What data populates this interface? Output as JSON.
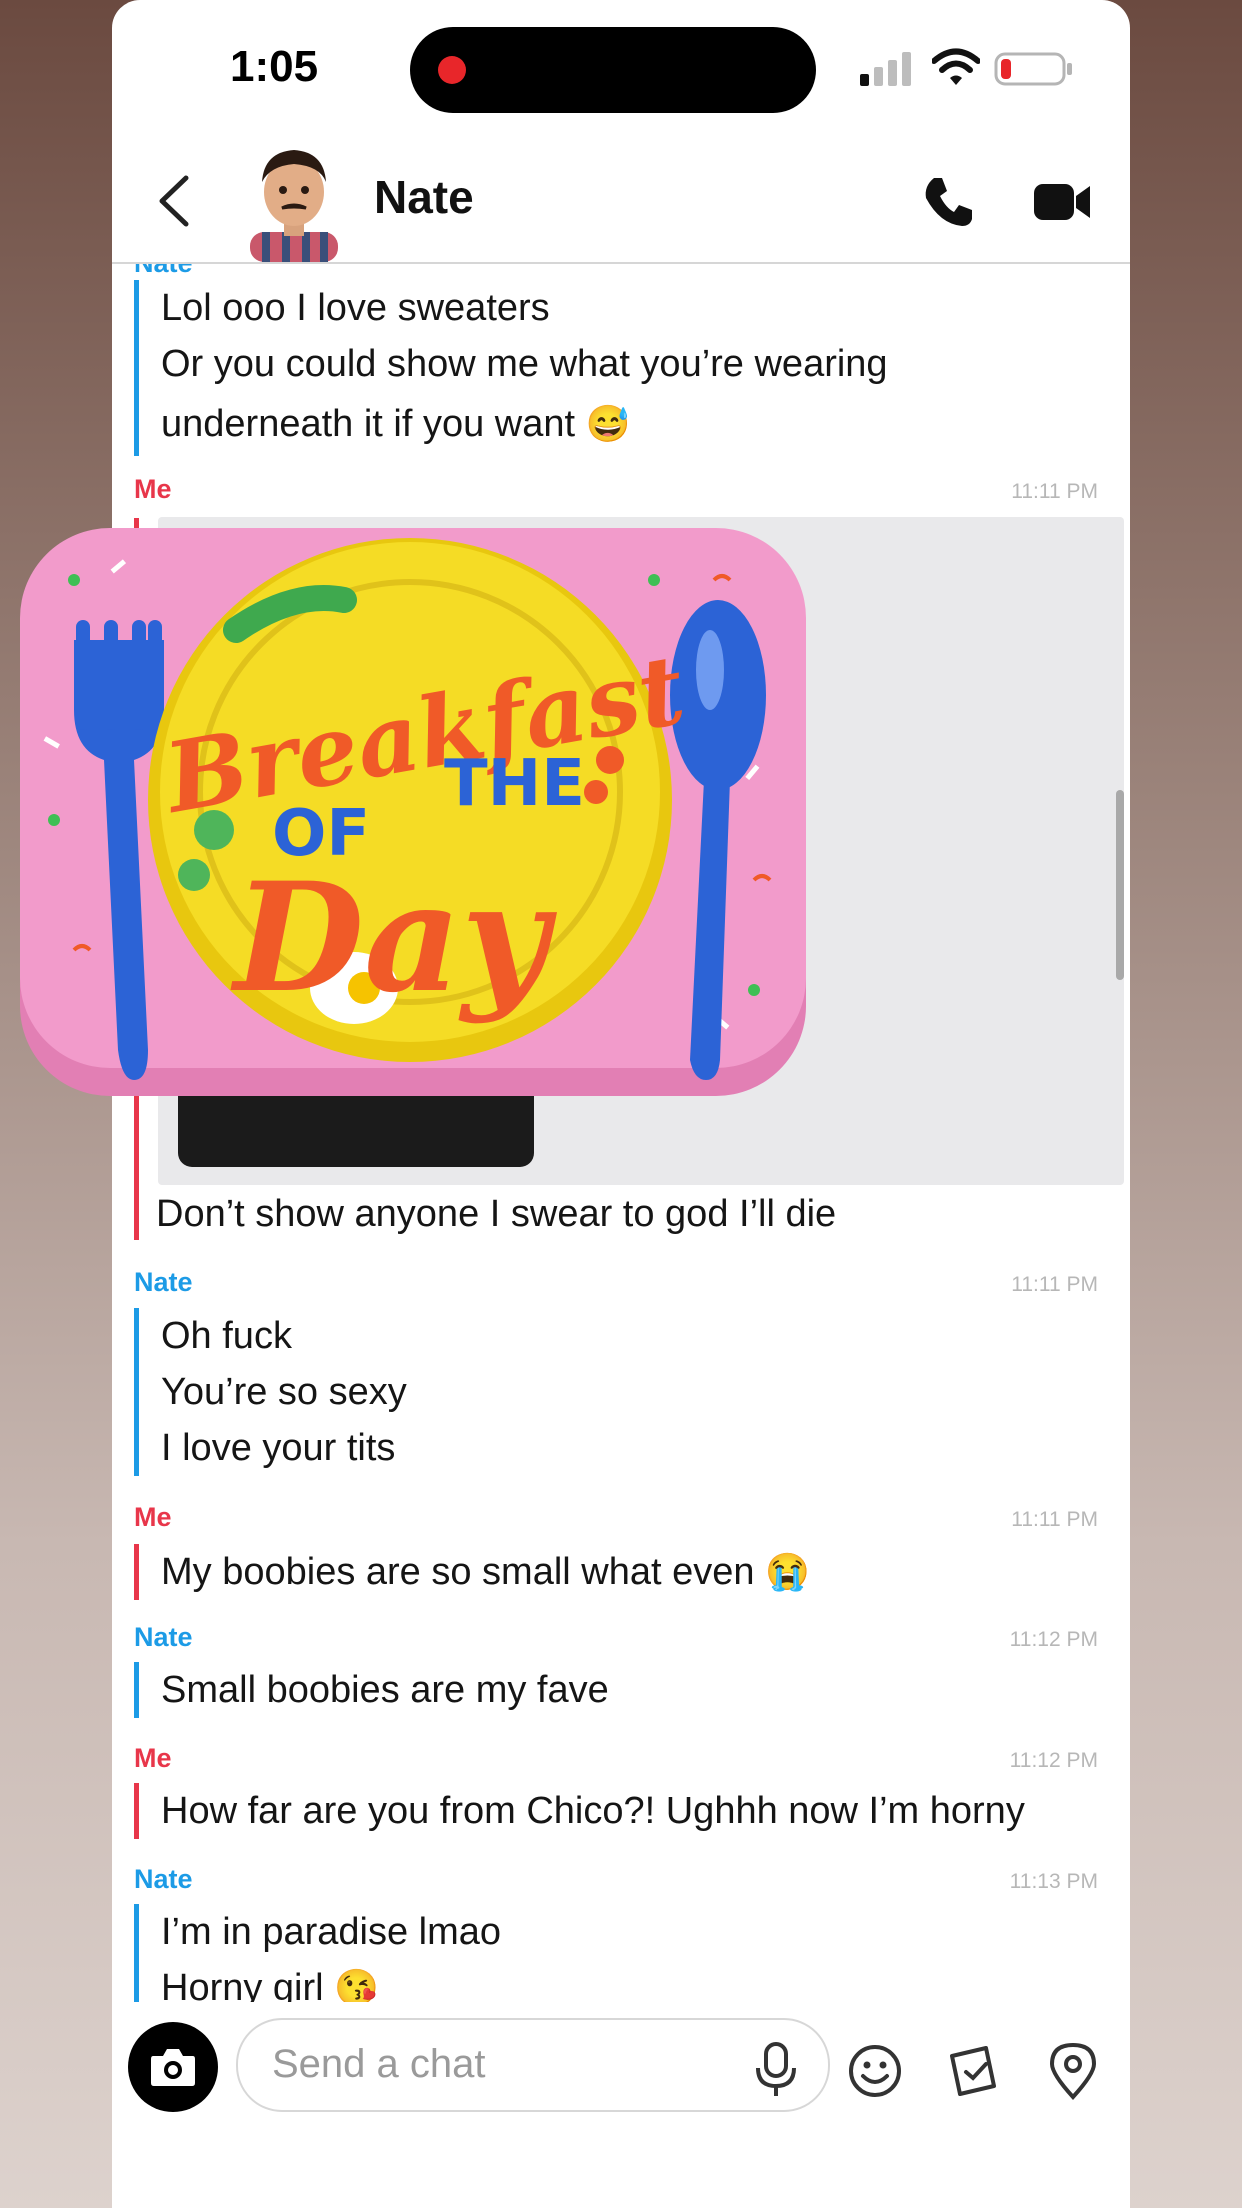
{
  "status_bar": {
    "time": "1:05"
  },
  "header": {
    "contact_name": "Nate"
  },
  "messages": {
    "m1": {
      "sender": "Nate",
      "lines": [
        "Lol ooo I love sweaters",
        "Or you could show me what you’re wearing",
        "underneath it if you want"
      ],
      "emoji": "😅"
    },
    "m2": {
      "sender": "Me",
      "time": "11:11 PM",
      "caption": "Don’t show anyone I swear to god I’ll die"
    },
    "m3": {
      "sender": "Nate",
      "time": "11:11 PM",
      "lines": [
        "Oh fuck",
        "You’re so sexy",
        "I love your tits"
      ]
    },
    "m4": {
      "sender": "Me",
      "time": "11:11 PM",
      "text": "My boobies are so small what even",
      "emoji": "😭"
    },
    "m5": {
      "sender": "Nate",
      "time": "11:12 PM",
      "text": "Small boobies are my fave"
    },
    "m6": {
      "sender": "Me",
      "time": "11:12 PM",
      "text": "How far are you from Chico?! Ughhh now I’m horny"
    },
    "m7": {
      "sender": "Nate",
      "time": "11:13 PM",
      "lines": [
        "I’m in paradise lmao",
        "Horny girl"
      ],
      "emoji": "😘"
    }
  },
  "sticker": {
    "lines": [
      "Breakfast",
      "OF",
      "THE",
      "Day"
    ]
  },
  "composer": {
    "placeholder": "Send a chat"
  },
  "icons": [
    "back-icon",
    "phone-icon",
    "video-camera-icon",
    "camera-icon",
    "microphone-icon",
    "smiley-icon",
    "memories-icon",
    "map-pin-icon"
  ],
  "colors": {
    "me": "#e8364a",
    "nate": "#1c9be6"
  }
}
